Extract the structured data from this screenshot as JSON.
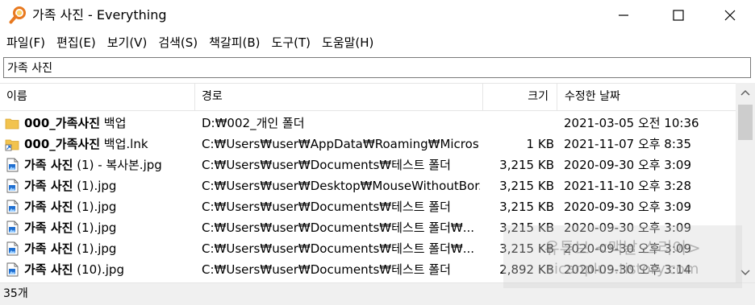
{
  "window": {
    "title": "가족 사진 - Everything"
  },
  "menu": [
    {
      "label": "파일(F)"
    },
    {
      "label": "편집(E)"
    },
    {
      "label": "보기(V)"
    },
    {
      "label": "검색(S)"
    },
    {
      "label": "책갈피(B)"
    },
    {
      "label": "도구(T)"
    },
    {
      "label": "도움말(H)"
    }
  ],
  "search": {
    "value": "가족 사진"
  },
  "columns": {
    "name": "이름",
    "path": "경로",
    "size": "크기",
    "date": "수정한 날짜"
  },
  "rows": [
    {
      "icon": "folder-icon",
      "name_bold": "000_가족사진",
      "name_rest": " 백업",
      "path": "D:₩002_개인 폴더",
      "size": "",
      "date": "2021-03-05 오전 10:36"
    },
    {
      "icon": "shortcut-icon",
      "name_bold": "000_가족사진",
      "name_rest": " 백업.lnk",
      "path": "C:₩Users₩user₩AppData₩Roaming₩Micros...",
      "size": "1 KB",
      "date": "2021-11-07 오후 8:35"
    },
    {
      "icon": "image-file-icon",
      "name_bold": "가족 사진",
      "name_rest": " (1) - 복사본.jpg",
      "path": "C:₩Users₩user₩Documents₩테스트 폴더",
      "size": "3,215 KB",
      "date": "2020-09-30 오후 3:09"
    },
    {
      "icon": "image-file-icon",
      "name_bold": "가족 사진",
      "name_rest": " (1).jpg",
      "path": "C:₩Users₩user₩Desktop₩MouseWithoutBor...",
      "size": "3,215 KB",
      "date": "2021-11-10 오후 3:28"
    },
    {
      "icon": "image-file-icon",
      "name_bold": "가족 사진",
      "name_rest": " (1).jpg",
      "path": "C:₩Users₩user₩Documents₩테스트 폴더",
      "size": "3,215 KB",
      "date": "2020-09-30 오후 3:09"
    },
    {
      "icon": "image-file-icon",
      "name_bold": "가족 사진",
      "name_rest": " (1).jpg",
      "path": "C:₩Users₩user₩Documents₩테스트 폴더₩...",
      "size": "3,215 KB",
      "date": "2020-09-30 오후 3:09"
    },
    {
      "icon": "image-file-icon",
      "name_bold": "가족 사진",
      "name_rest": " (1).jpg",
      "path": "C:₩Users₩user₩Documents₩테스트 폴더₩...",
      "size": "3,215 KB",
      "date": "2020-09-30 오후 3:09"
    },
    {
      "icon": "image-file-icon",
      "name_bold": "가족 사진",
      "name_rest": " (10).jpg",
      "path": "C:₩Users₩user₩Documents₩테스트 폴더",
      "size": "2,892 KB",
      "date": "2020-09-30 오후 3:14"
    }
  ],
  "status": {
    "count": "35개"
  },
  "watermark": {
    "line1": "유튜브 <맥날 스리아>",
    "line2": "sicanplus.tistory.com"
  },
  "colors": {
    "folder": "#f2c34e",
    "app_icon": "#e8791f",
    "file_icon_fill": "#1f6fd1"
  }
}
